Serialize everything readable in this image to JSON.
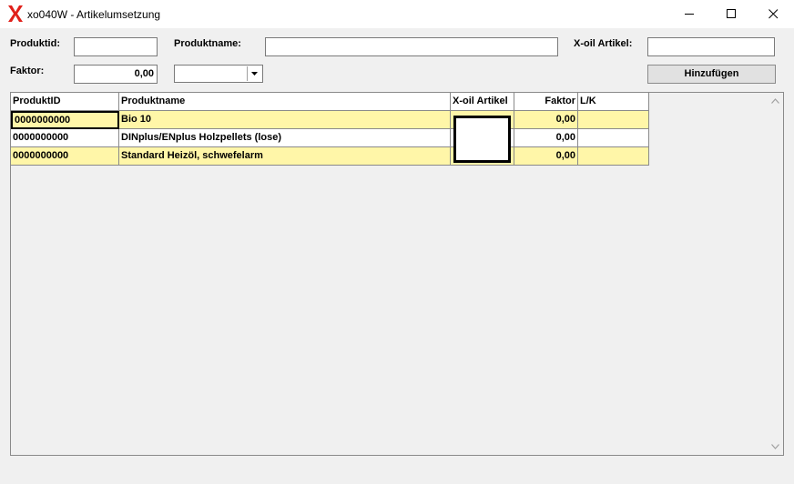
{
  "window": {
    "title": "xo040W - Artikelumsetzung",
    "icon": "x-logo-icon",
    "accent_color": "#e0201a",
    "controls": [
      "minimize-icon",
      "maximize-icon",
      "close-icon"
    ]
  },
  "form": {
    "produktid_label": "Produktid:",
    "produktid_value": "",
    "produktname_label": "Produktname:",
    "produktname_value": "",
    "xoil_label": "X-oil Artikel:",
    "xoil_value": "",
    "faktor_label": "Faktor:",
    "faktor_value": "0,00",
    "unit_select_value": "",
    "add_button_label": "Hinzufügen"
  },
  "table": {
    "headers": {
      "produktid": "ProduktID",
      "produktname": "Produktname",
      "xoil": "X-oil Artikel",
      "faktor": "Faktor",
      "lk": "L/K"
    },
    "rows": [
      {
        "produktid": "0000000000",
        "produktname": "Bio 10",
        "xoil": "",
        "faktor": "0,00",
        "lk": "",
        "color": "#fff6a8"
      },
      {
        "produktid": "0000000000",
        "produktname": "DINplus/ENplus Holzpellets (lose)",
        "xoil": "",
        "faktor": "0,00",
        "lk": "",
        "color": "#ffffff"
      },
      {
        "produktid": "0000000000",
        "produktname": "Standard Heizöl, schwefelarm",
        "xoil": "",
        "faktor": "0,00",
        "lk": "",
        "color": "#fff6a8"
      }
    ]
  }
}
